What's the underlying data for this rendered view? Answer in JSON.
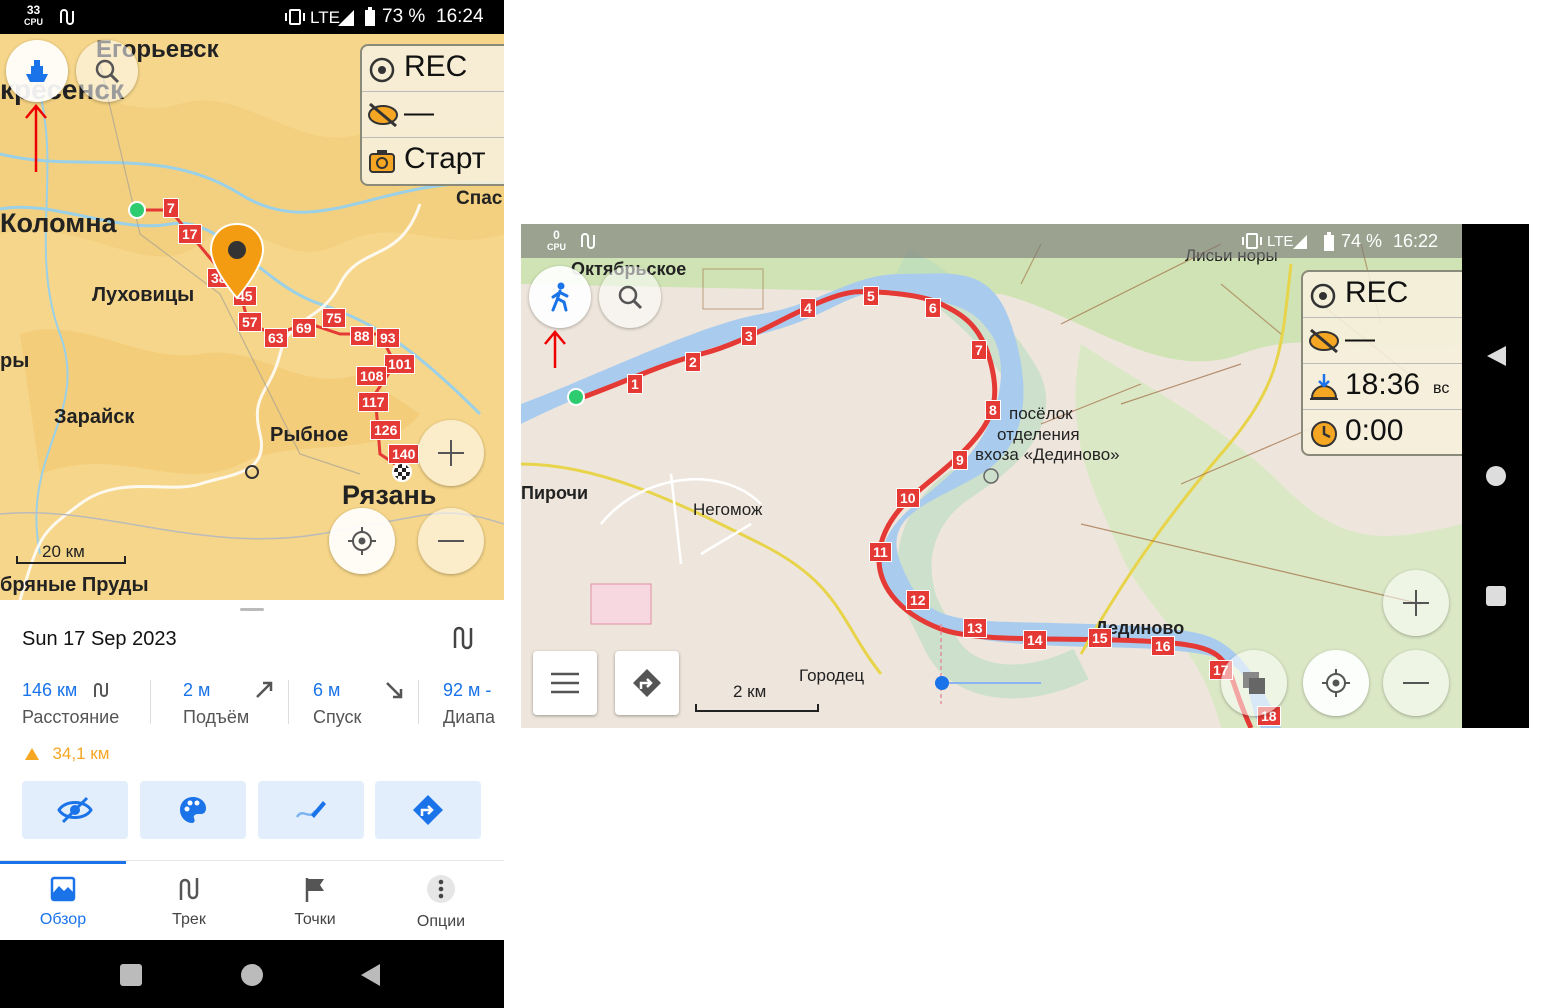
{
  "phone1": {
    "status": {
      "cpu_value": "33",
      "cpu_label": "CPU",
      "network": "LTE",
      "battery": "73 %",
      "time": "16:24"
    },
    "map": {
      "labels": {
        "egorievsk": "Егорьевск",
        "voskresensk": "кресенск",
        "kolomna": "Коломна",
        "lukhovitsy": "Луховицы",
        "ory": "ры",
        "zaraysk": "Зарайск",
        "rybnoe": "Рыбное",
        "ryazan": "Рязань",
        "spas": "Спас",
        "prudy": "бряные Пруды"
      },
      "km_markers": [
        "7",
        "17",
        "38",
        "45",
        "57",
        "63",
        "69",
        "75",
        "88",
        "93",
        "101",
        "108",
        "117",
        "126",
        "140"
      ],
      "scale_label": "20 км"
    },
    "widget": {
      "rec": "REC",
      "hidden": "—",
      "camera": "Старт"
    },
    "panel": {
      "date": "Sun 17 Sep 2023",
      "stats": [
        {
          "value": "146 км",
          "label": "Расстояние",
          "icon": "route-icon"
        },
        {
          "value": "2 м",
          "label": "Подъём",
          "icon": "ascent-icon"
        },
        {
          "value": "6 м",
          "label": "Спуск",
          "icon": "descent-icon"
        },
        {
          "value": "92 м -",
          "label": "Диапа",
          "icon": ""
        }
      ],
      "elevation_note": "34,1 км",
      "actions": [
        "eye-off-icon",
        "palette-icon",
        "edit-track-icon",
        "directions-icon"
      ]
    },
    "bottom_nav": [
      {
        "label": "Обзор",
        "icon": "overview-icon",
        "active": true
      },
      {
        "label": "Трек",
        "icon": "track-icon",
        "active": false
      },
      {
        "label": "Точки",
        "icon": "flag-icon",
        "active": false
      },
      {
        "label": "Опции",
        "icon": "more-icon",
        "active": false
      }
    ]
  },
  "phone2": {
    "status": {
      "cpu_value": "0",
      "cpu_label": "CPU",
      "network": "LTE",
      "battery": "74 %",
      "time": "16:22"
    },
    "map": {
      "labels": {
        "oktyabrskoe": "Октябрьское",
        "lisy_nory": "Лисьи норы",
        "poselok1": "посёлок",
        "poselok2": "отделения",
        "poselok3": "вхоза «Дединово»",
        "pirochi": "Пирочи",
        "negomozh": "Негомож",
        "gorodets": "Городец",
        "dedinovo": "Дединово"
      },
      "km_markers": [
        "1",
        "2",
        "3",
        "4",
        "5",
        "6",
        "7",
        "8",
        "9",
        "10",
        "11",
        "12",
        "13",
        "14",
        "15",
        "16",
        "17",
        "18"
      ],
      "scale_label": "2 км"
    },
    "widget": {
      "rec": "REC",
      "hidden": "—",
      "sunset": "18:36",
      "sunset_suffix": "вс",
      "timer": "0:00"
    }
  },
  "colors": {
    "accent": "#1a73e8",
    "track": "#e53935",
    "orange": "#f5a623",
    "map_yellow": "#f6d68a",
    "map_green": "#cfe3b4"
  }
}
